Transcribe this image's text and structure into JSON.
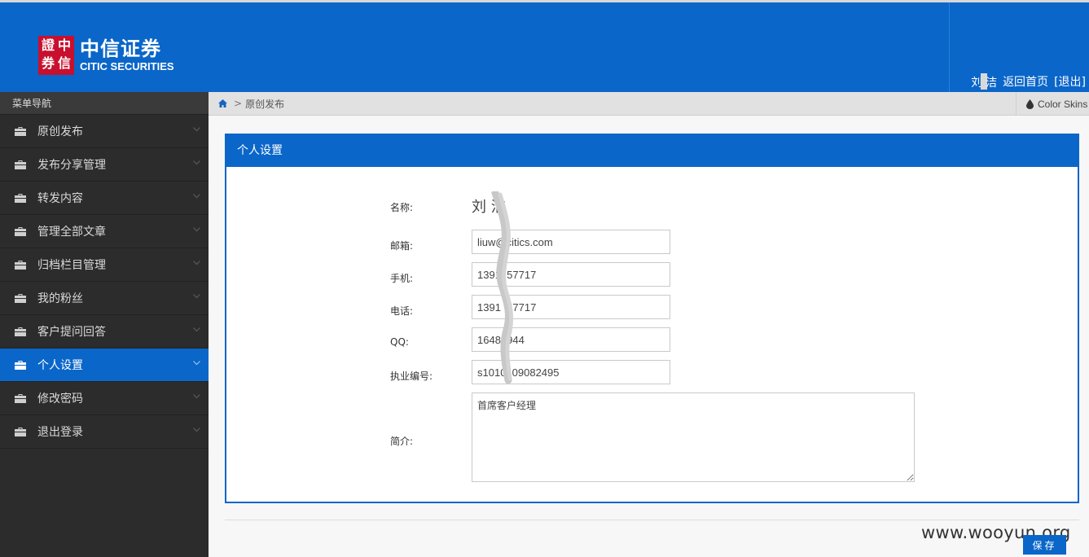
{
  "header": {
    "logo_seal_chars": [
      "證",
      "中",
      "券",
      "信"
    ],
    "logo_cn": "中信证券",
    "logo_en": "CITIC SECURITIES",
    "user_name_part1": "刘",
    "user_name_part2": "洁",
    "home_link": "返回首页",
    "logout_link": "[退出]"
  },
  "sidebar": {
    "title": "菜单导航",
    "items": [
      {
        "label": "原创发布"
      },
      {
        "label": "发布分享管理"
      },
      {
        "label": "转发内容"
      },
      {
        "label": "管理全部文章"
      },
      {
        "label": "归档栏目管理"
      },
      {
        "label": "我的粉丝"
      },
      {
        "label": "客户提问回答"
      },
      {
        "label": "个人设置",
        "active": true
      },
      {
        "label": "修改密码"
      },
      {
        "label": "退出登录"
      }
    ]
  },
  "breadcrumb": {
    "sep": ">",
    "current": "原创发布",
    "color_skins": "Color Skins"
  },
  "panel": {
    "title": "个人设置",
    "fields": {
      "name_label": "名称:",
      "name_value": "刘  洁",
      "email_label": "邮箱:",
      "email_value": "liuw@citics.com",
      "mobile_label": "手机:",
      "mobile_value": "1391  57717",
      "phone_label": "电话:",
      "phone_value": "1391  57717",
      "qq_label": "QQ:",
      "qq_value": "1648  944",
      "license_label": "执业编号:",
      "license_value": "s1010  09082495",
      "intro_label": "简介:",
      "intro_value": "首席客户经理"
    }
  },
  "footer": {
    "watermark": "www.wooyun.org",
    "save_label": "保存"
  },
  "colors": {
    "brand_blue": "#0a66c9",
    "sidebar_bg": "#2c2c2c",
    "logo_red": "#c8102e"
  }
}
